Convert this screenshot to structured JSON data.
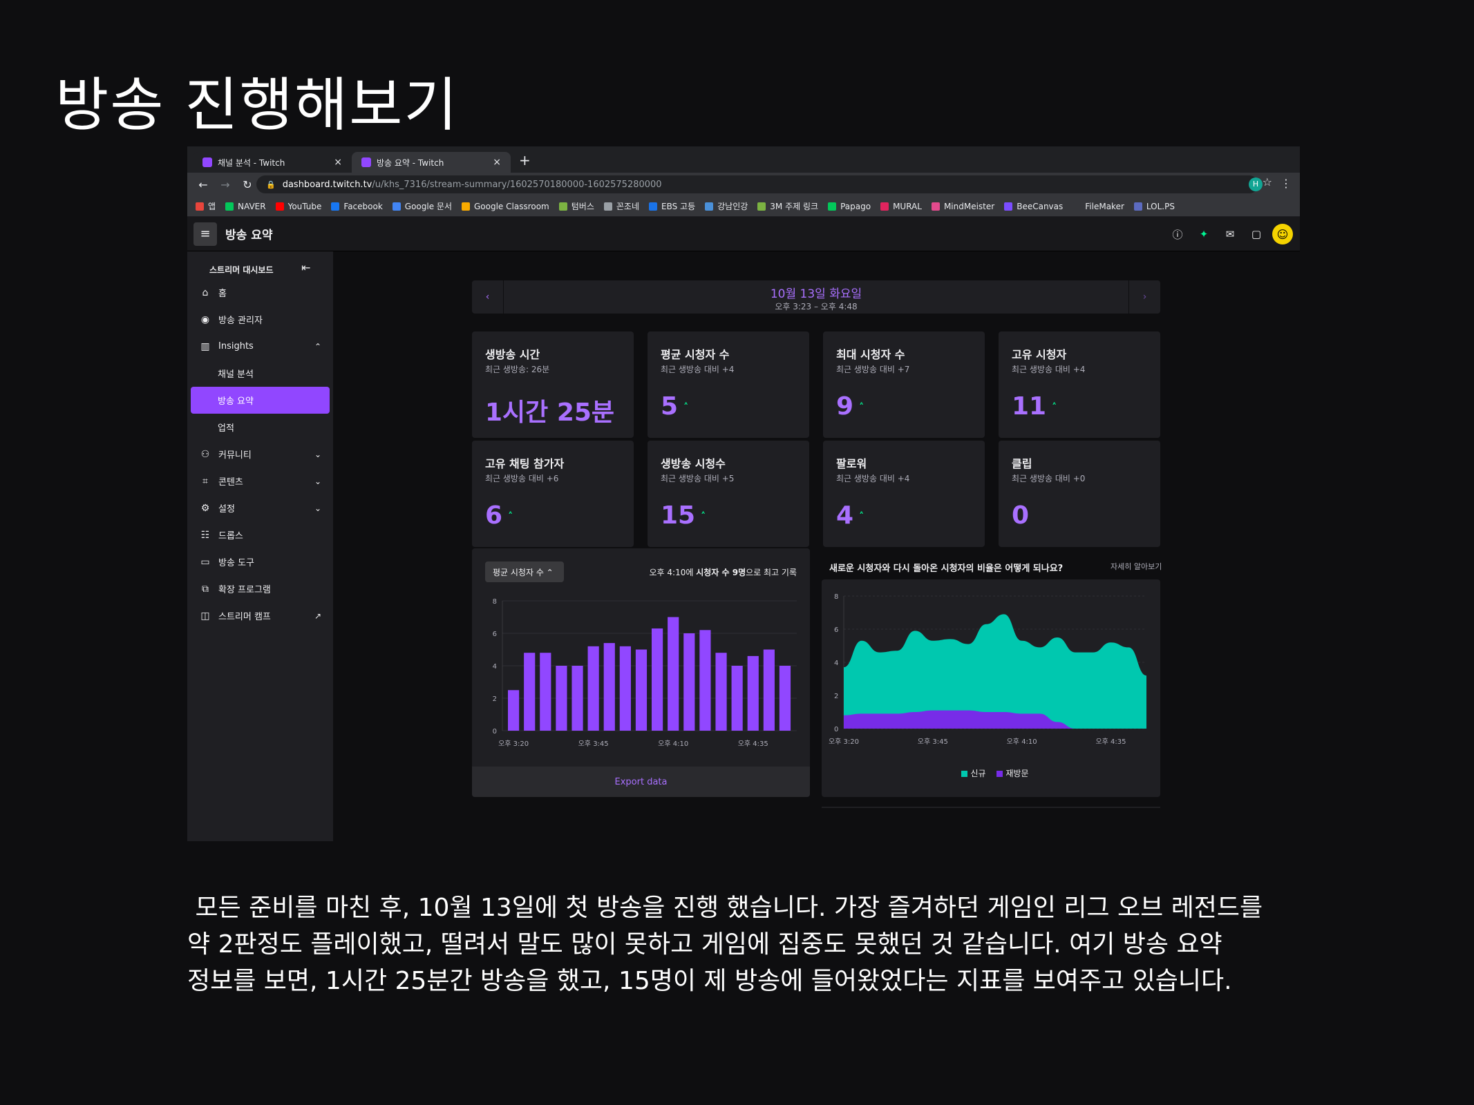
{
  "slide": {
    "title": "방송 진행해보기",
    "caption": " 모든 준비를 마친 후, 10월 13일에 첫 방송을 진행 했습니다. 가장 즐겨하던 게임인 리그 오브 레전드를\n약 2판정도 플레이했고, 떨려서 말도 많이 못하고 게임에 집중도 못했던 것 같습니다. 여기 방송 요약\n정보를 보면, 1시간 25분간 방송을 했고, 15명이 제 방송에 들어왔었다는 지표를 보여주고 있습니다."
  },
  "browser": {
    "tabs": [
      {
        "title": "채널 분석 - Twitch",
        "close": "×"
      },
      {
        "title": "방송 요약 - Twitch",
        "close": "×"
      }
    ],
    "new_tab": "+",
    "url_host": "dashboard.twitch.tv",
    "url_path": "/u/khs_7316/stream-summary/1602570180000-1602575280000",
    "profile_initial": "H",
    "bookmarks": [
      {
        "label": "앱",
        "color": "#e8453c"
      },
      {
        "label": "NAVER",
        "color": "#03c75a"
      },
      {
        "label": "YouTube",
        "color": "#ff0000"
      },
      {
        "label": "Facebook",
        "color": "#1877f2"
      },
      {
        "label": "Google 문서",
        "color": "#4285f4"
      },
      {
        "label": "Google Classroom",
        "color": "#f9ab00"
      },
      {
        "label": "텀버스",
        "color": "#7cb342"
      },
      {
        "label": "꼰조네",
        "color": "#9aa0a6"
      },
      {
        "label": "EBS 고등",
        "color": "#1a73e8"
      },
      {
        "label": "강남인강",
        "color": "#4a90d9"
      },
      {
        "label": "3M 주제 링크",
        "color": "#7cb342"
      },
      {
        "label": "Papago",
        "color": "#03c75a"
      },
      {
        "label": "MURAL",
        "color": "#e0245e"
      },
      {
        "label": "MindMeister",
        "color": "#e24a8d"
      },
      {
        "label": "BeeCanvas",
        "color": "#7b4dff"
      },
      {
        "label": "FileMaker",
        "color": "#35363a"
      },
      {
        "label": "LOL.PS",
        "color": "#5c6bc0"
      }
    ]
  },
  "twitch": {
    "page_title": "방송 요약",
    "sidebar": {
      "header": "스트리머 대시보드",
      "items": [
        {
          "label": "홈",
          "icon": "home-icon",
          "glyph": "⌂"
        },
        {
          "label": "방송 관리자",
          "icon": "broadcast-icon",
          "glyph": "◉"
        },
        {
          "label": "Insights",
          "icon": "insights-icon",
          "glyph": "▥",
          "chevron": "⌃"
        },
        {
          "label": "채널 분석",
          "sub": true
        },
        {
          "label": "방송 요약",
          "sub": true,
          "active": true
        },
        {
          "label": "업적",
          "sub": true
        },
        {
          "label": "커뮤니티",
          "icon": "community-icon",
          "glyph": "⚇",
          "chevron": "⌄"
        },
        {
          "label": "콘텐츠",
          "icon": "content-icon",
          "glyph": "⌗",
          "chevron": "⌄"
        },
        {
          "label": "설정",
          "icon": "settings-icon",
          "glyph": "⚙",
          "chevron": "⌄"
        },
        {
          "label": "드롭스",
          "icon": "drops-icon",
          "glyph": "☷"
        },
        {
          "label": "방송 도구",
          "icon": "stream-tools-icon",
          "glyph": "▭"
        },
        {
          "label": "확장 프로그램",
          "icon": "extensions-icon",
          "glyph": "⧉"
        },
        {
          "label": "스트리머 캠프",
          "icon": "camp-icon",
          "glyph": "◫",
          "chevron": "↗"
        }
      ]
    },
    "date": {
      "day": "10월 13일 화요일",
      "range": "오후 3:23 – 오후 4:48"
    },
    "cards": [
      {
        "title": "생방송 시간",
        "sub": "최근 생방송: 26분",
        "value": "1시간 25분",
        "up": false
      },
      {
        "title": "평균 시청자 수",
        "sub": "최근 생방송 대비 +4",
        "value": "5",
        "up": true
      },
      {
        "title": "최대 시청자 수",
        "sub": "최근 생방송 대비 +7",
        "value": "9",
        "up": true
      },
      {
        "title": "고유 시청자",
        "sub": "최근 생방송 대비 +4",
        "value": "11",
        "up": true
      },
      {
        "title": "고유 채팅 참가자",
        "sub": "최근 생방송 대비 +6",
        "value": "6",
        "up": true
      },
      {
        "title": "생방송 시청수",
        "sub": "최근 생방송 대비 +5",
        "value": "15",
        "up": true
      },
      {
        "title": "팔로워",
        "sub": "최근 생방송 대비 +4",
        "value": "4",
        "up": true
      },
      {
        "title": "클립",
        "sub": "최근 생방송 대비 +0",
        "value": "0",
        "up": false
      }
    ],
    "up_glyph": "˄",
    "viewer_chart": {
      "selector": "평균 시청자 수 ⌃",
      "peak_note_prefix": "오후 4:10에 ",
      "peak_note_bold": "시청자 수 9명",
      "peak_note_suffix": "으로 최고 기록",
      "export": "Export data"
    },
    "ratio_chart": {
      "question": "새로운 시청자와 다시 돌아온 시청자의 비율은 어떻게 되나요?",
      "more": "자세히 알아보기",
      "legend": [
        {
          "label": "신규",
          "color": "#00c8af"
        },
        {
          "label": "재방문",
          "color": "#772ce8"
        }
      ]
    }
  },
  "chart_data": [
    {
      "type": "bar",
      "title": "",
      "categories": [
        "오후 3:20",
        "",
        "",
        "",
        "",
        "오후 3:45",
        "",
        "",
        "",
        "",
        "오후 4:10",
        "",
        "",
        "",
        "",
        "오후 4:35",
        "",
        ""
      ],
      "values": [
        2.5,
        4.8,
        4.8,
        4,
        4,
        5.2,
        5.4,
        5.2,
        5,
        6.3,
        7,
        6,
        6.2,
        4.8,
        4,
        4.6,
        5,
        4
      ],
      "x_ticks": [
        "오후 3:20",
        "오후 3:45",
        "오후 4:10",
        "오후 4:35"
      ],
      "y_ticks": [
        "0",
        "2",
        "4",
        "6",
        "8"
      ],
      "ylim": [
        0,
        8
      ],
      "color": "#9147ff",
      "grid": true
    },
    {
      "type": "area",
      "title": "새로운 시청자와 다시 돌아온 시청자의 비율은 어떻게 되나요?",
      "x": [
        "오후 3:20",
        "",
        "",
        "",
        "",
        "오후 3:45",
        "",
        "",
        "",
        "",
        "오후 4:10",
        "",
        "",
        "",
        "",
        "오후 4:35",
        "",
        ""
      ],
      "x_ticks": [
        "오후 3:20",
        "오후 3:45",
        "오후 4:10",
        "오후 4:35"
      ],
      "y_ticks": [
        "0",
        "2",
        "4",
        "6",
        "8"
      ],
      "ylim": [
        0,
        8
      ],
      "series": [
        {
          "name": "신규",
          "color": "#00c8af",
          "values": [
            3.7,
            5.3,
            4.6,
            4.7,
            5.9,
            5.3,
            5.4,
            5.1,
            6.3,
            6.9,
            5.3,
            4.9,
            5.5,
            4.6,
            4.6,
            5.2,
            4.9,
            3.2
          ]
        },
        {
          "name": "재방문",
          "color": "#772ce8",
          "values": [
            0.8,
            0.9,
            0.9,
            0.9,
            1.0,
            1.1,
            1.1,
            1.1,
            1.0,
            1.0,
            0.9,
            0.9,
            0.4,
            0,
            0,
            0,
            0,
            0
          ]
        }
      ],
      "legend": "bottom",
      "grid": true
    }
  ]
}
